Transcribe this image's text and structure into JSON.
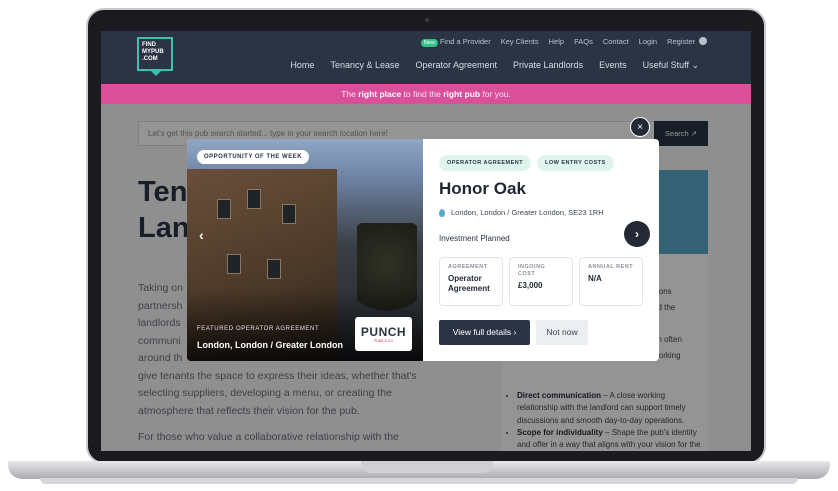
{
  "logo": {
    "line1": "FIND",
    "line2": "MYPUB",
    "line3": ".COM"
  },
  "top_links": {
    "new_badge": "New",
    "items": [
      "Find a Provider",
      "Key Clients",
      "Help",
      "FAQs",
      "Contact",
      "Login",
      "Register"
    ]
  },
  "main_nav": [
    "Home",
    "Tenancy & Lease",
    "Operator Agreement",
    "Private Landlords",
    "Events",
    "Useful Stuff ⌄"
  ],
  "banner": {
    "pre": "The ",
    "highlight1": "right place",
    "mid": " to find the ",
    "highlight2": "right pub",
    "post": " for you."
  },
  "search": {
    "placeholder": "Let's get this pub search started... type in your search location here!",
    "button": "Search ↗"
  },
  "page": {
    "hero_title": "Ten a Pr Lan",
    "body_lines": [
      "Taking on",
      "partnersh",
      "landlords",
      "communi",
      "around th"
    ],
    "body_full": [
      "give tenants the space to express their ideas, whether that's",
      "selecting suppliers, developing a menu, or creating the",
      "atmosphere that reflects their vision for the pub."
    ],
    "body_lower": "For those who value a collaborative relationship with the",
    "side_lines": [
      "sions",
      "nd the",
      "",
      "an often",
      "working"
    ],
    "bullets": [
      {
        "title": "Direct communication",
        "text": " – A close working relationship with the landlord can support timely discussions and smooth day-to-day operations."
      },
      {
        "title": "Scope for individuality",
        "text": " – Shape the pub's identity and offer in a way that aligns with your vision for the business."
      }
    ]
  },
  "modal": {
    "badge": "OPPORTUNITY OF THE WEEK",
    "featured_label": "FEATURED OPERATOR AGREEMENT",
    "featured_location": "London, London / Greater London",
    "brand": "PUNCH",
    "brand_sub": "PUBS & CO",
    "tags": [
      "OPERATOR AGREEMENT",
      "LOW ENTRY COSTS"
    ],
    "pub_name": "Honor Oak",
    "location": "London, London / Greater London, SE23 1RH",
    "investment": "Investment Planned",
    "stats": [
      {
        "label": "AGREEMENT",
        "value": "Operator Agreement"
      },
      {
        "label": "INGOING COST",
        "value": "£3,000"
      },
      {
        "label": "ANNUAL RENT",
        "value": "N/A"
      }
    ],
    "view_button": "View full details ›",
    "not_now_button": "Not now",
    "close": "×",
    "prev": "‹",
    "next": "›"
  }
}
